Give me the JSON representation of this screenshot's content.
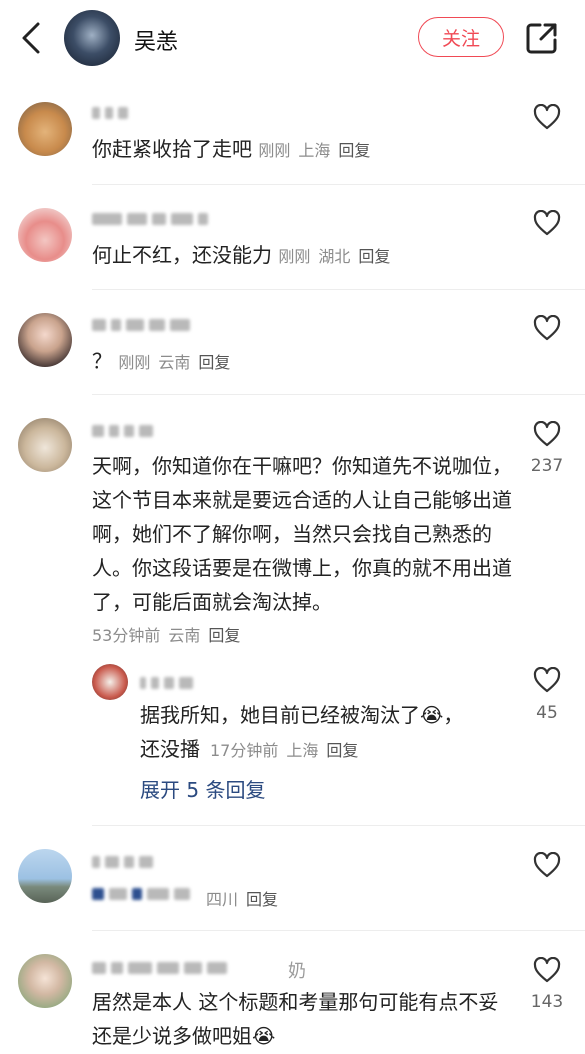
{
  "header": {
    "user_name": "吴恙",
    "follow_label": "关注",
    "back_icon": "chevron-left-icon",
    "share_icon": "share-icon"
  },
  "comments": [
    {
      "text": "你赶紧收拾了走吧",
      "time": "刚刚",
      "location": "上海",
      "reply": "回复",
      "likes": ""
    },
    {
      "text": "何止不红，还没能力",
      "time": "刚刚",
      "location": "湖北",
      "reply": "回复",
      "likes": ""
    },
    {
      "text": "？",
      "time": "刚刚",
      "location": "云南",
      "reply": "回复",
      "likes": ""
    },
    {
      "text": "天啊，你知道你在干嘛吧？你知道先不说咖位，这个节目本来就是要远合适的人让自己能够出道啊，她们不了解你啊，当然只会找自己熟悉的人。你这段话要是在微博上，你真的就不用出道了，可能后面就会淘汰掉。",
      "time": "53分钟前",
      "location": "云南",
      "reply": "回复",
      "likes": "237"
    },
    {
      "text": "",
      "time": "",
      "location": "四川",
      "reply": "回复",
      "likes": ""
    },
    {
      "text": "居然是本人 这个标题和考量那句可能有点不妥 还是少说多做吧姐",
      "suffix_emoji": "😭",
      "time": "",
      "location": "",
      "reply": "",
      "likes": "143",
      "name_suffix": "奶"
    }
  ],
  "sub_reply": {
    "text": "据我所知，她目前已经被淘汰了😭，还没播",
    "time": "17分钟前",
    "location": "上海",
    "reply": "回复",
    "likes": "45"
  },
  "expand_label": "展开 5 条回复",
  "colors": {
    "accent": "#f04a55",
    "link": "#2b4a80",
    "meta": "#8c8c8c"
  }
}
